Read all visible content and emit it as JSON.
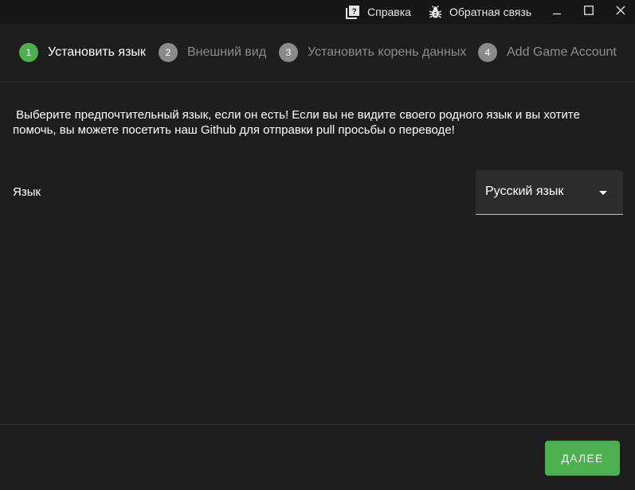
{
  "titlebar": {
    "help_label": "Справка",
    "help_icon": "help-book-icon",
    "feedback_label": "Обратная связь",
    "feedback_icon": "bug-icon",
    "window_controls": [
      "minimize-icon",
      "maximize-icon",
      "close-icon"
    ]
  },
  "stepper": {
    "steps": [
      {
        "number": "1",
        "label": "Установить язык",
        "active": true
      },
      {
        "number": "2",
        "label": "Внешний вид",
        "active": false
      },
      {
        "number": "3",
        "label": "Установить корень данных",
        "active": false
      },
      {
        "number": "4",
        "label": "Add Game Account",
        "active": false
      }
    ]
  },
  "main": {
    "description": " Выберите предпочтительный язык, если он есть! Если вы не видите своего родного язык и вы хотите помочь, вы можете посетить наш Github для отправки pull просьбы о переводе!",
    "language_label": "Язык",
    "language_value": "Русский язык"
  },
  "footer": {
    "next_label": "ДАЛЕЕ"
  },
  "colors": {
    "accent": "#4caf50",
    "background": "#1e1e1e",
    "titlebar": "#161616",
    "inactive_step": "#8a8a8a"
  }
}
